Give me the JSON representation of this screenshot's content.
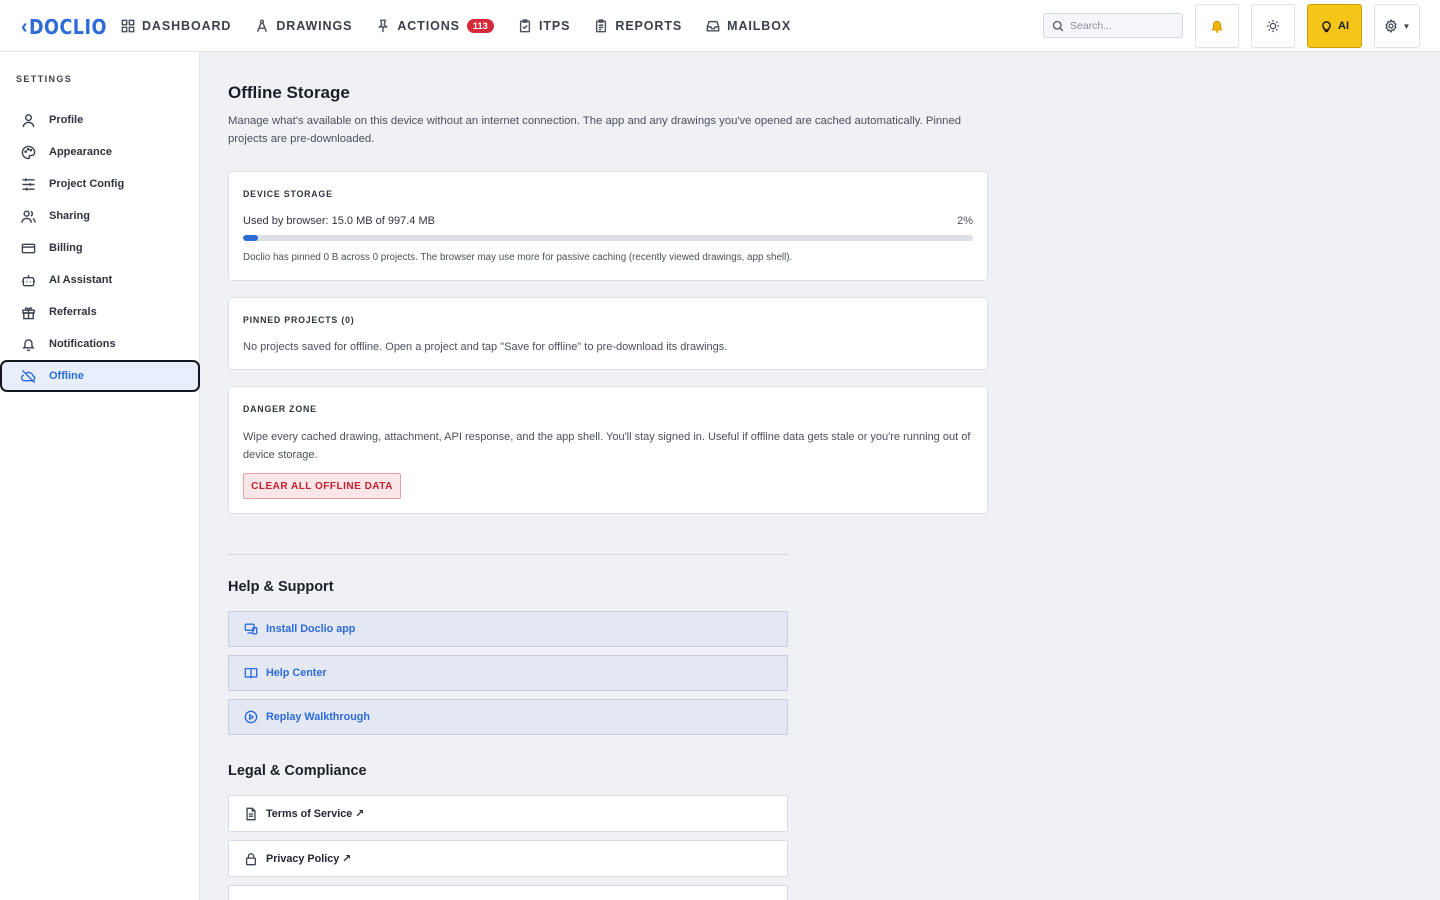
{
  "brand": {
    "name": "DOCLIO",
    "color": "#2c6bd8"
  },
  "nav": {
    "items": [
      {
        "label": "DASHBOARD",
        "icon": "dashboard-icon"
      },
      {
        "label": "DRAWINGS",
        "icon": "drawings-icon"
      },
      {
        "label": "ACTIONS",
        "icon": "pin-icon",
        "badge": "113"
      },
      {
        "label": "ITPS",
        "icon": "clipboard-check-icon"
      },
      {
        "label": "REPORTS",
        "icon": "report-icon"
      },
      {
        "label": "MAILBOX",
        "icon": "inbox-icon"
      }
    ]
  },
  "header": {
    "search_placeholder": "Search...",
    "ai_label": "AI",
    "accent": "#f5c518"
  },
  "sidebar": {
    "heading": "SETTINGS",
    "items": [
      {
        "label": "Profile",
        "icon": "user-icon"
      },
      {
        "label": "Appearance",
        "icon": "palette-icon"
      },
      {
        "label": "Project Config",
        "icon": "sliders-icon"
      },
      {
        "label": "Sharing",
        "icon": "users-icon"
      },
      {
        "label": "Billing",
        "icon": "credit-card-icon"
      },
      {
        "label": "AI Assistant",
        "icon": "bot-icon"
      },
      {
        "label": "Referrals",
        "icon": "gift-icon"
      },
      {
        "label": "Notifications",
        "icon": "bell-icon"
      },
      {
        "label": "Offline",
        "icon": "cloud-off-icon",
        "active": true
      }
    ]
  },
  "main": {
    "title": "Offline Storage",
    "description": "Manage what's available on this device without an internet connection. The app and any drawings you've opened are cached automatically. Pinned projects are pre-downloaded.",
    "storage": {
      "title": "DEVICE STORAGE",
      "used_text": "Used by browser: 15.0 MB of 997.4 MB",
      "percent_label": "2%",
      "percent": 2,
      "note": "Doclio has pinned 0 B across 0 projects. The browser may use more for passive caching (recently viewed drawings, app shell)."
    },
    "pinned": {
      "title": "PINNED PROJECTS (0)",
      "text": "No projects saved for offline. Open a project and tap \"Save for offline\" to pre-download its drawings."
    },
    "danger": {
      "title": "DANGER ZONE",
      "text": "Wipe every cached drawing, attachment, API response, and the app shell. You'll stay signed in. Useful if offline data gets stale or you're running out of device storage.",
      "button": "CLEAR ALL OFFLINE DATA"
    },
    "help": {
      "title": "Help & Support",
      "items": [
        {
          "label": "Install Doclio app",
          "icon": "devices-icon"
        },
        {
          "label": "Help Center",
          "icon": "book-icon"
        },
        {
          "label": "Replay Walkthrough",
          "icon": "play-circle-icon"
        }
      ]
    },
    "legal": {
      "title": "Legal & Compliance",
      "items": [
        {
          "label": "Terms of Service ↗",
          "icon": "document-icon"
        },
        {
          "label": "Privacy Policy ↗",
          "icon": "lock-icon"
        }
      ]
    }
  }
}
